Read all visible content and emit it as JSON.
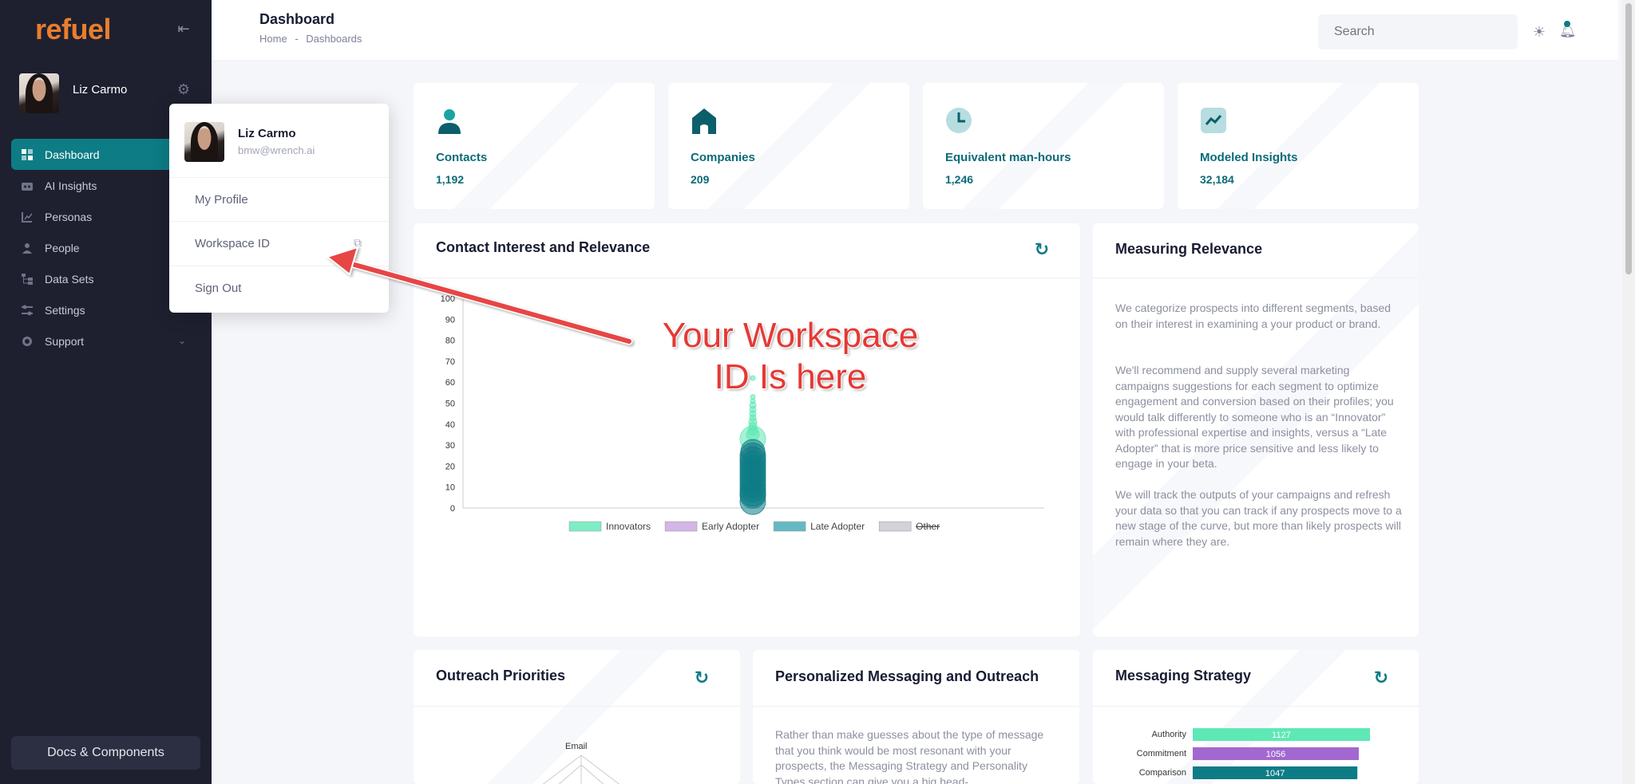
{
  "app": {
    "logo_text": "refuel"
  },
  "sidebar": {
    "user_name": "Liz Carmo",
    "items": [
      {
        "label": "Dashboard",
        "icon": "dashboard-icon",
        "active": true
      },
      {
        "label": "AI Insights",
        "icon": "ai-insights-icon"
      },
      {
        "label": "Personas",
        "icon": "personas-icon"
      },
      {
        "label": "People",
        "icon": "people-icon"
      },
      {
        "label": "Data Sets",
        "icon": "data-sets-icon"
      },
      {
        "label": "Settings",
        "icon": "settings-icon"
      },
      {
        "label": "Support",
        "icon": "support-icon",
        "has_chevron": true
      }
    ],
    "docs_button": "Docs & Components"
  },
  "header": {
    "title": "Dashboard",
    "breadcrumb": [
      "Home",
      "-",
      "Dashboards"
    ],
    "search_placeholder": "Search"
  },
  "stats": [
    {
      "label": "Contacts",
      "value": "1,192",
      "icon": "contact-icon"
    },
    {
      "label": "Companies",
      "value": "209",
      "icon": "building-icon"
    },
    {
      "label": "Equivalent man-hours",
      "value": "1,246",
      "icon": "clock-icon"
    },
    {
      "label": "Modeled Insights",
      "value": "32,184",
      "icon": "trend-icon"
    }
  ],
  "cards": {
    "interest": {
      "title": "Contact Interest and Relevance"
    },
    "measuring": {
      "title": "Measuring Relevance",
      "paragraphs": [
        "We categorize prospects into different segments, based on their interest in examining a your product or brand.",
        "We'll recommend and supply several marketing campaigns suggestions for each segment to optimize engagement and conversion based on their profiles; you would talk differently to someone who is an “Innovator” with professional expertise and insights, versus a “Late Adopter” that is more price sensitive and less likely to engage in your beta.",
        "We will track the outputs of your campaigns and refresh your data so that you can track if any prospects move to a new stage of the curve, but more than likely prospects will remain where they are."
      ]
    },
    "outreach": {
      "title": "Outreach Priorities",
      "radar_label": "Email"
    },
    "personalized": {
      "title": "Personalized Messaging and Outreach",
      "text": "Rather than make guesses about the type of message that you think would be most resonant with your prospects, the Messaging Strategy and Personality Types section can give you a big head-"
    },
    "messaging": {
      "title": "Messaging Strategy"
    }
  },
  "chart_data": [
    {
      "type": "scatter",
      "title": "Contact Interest and Relevance",
      "ylim": [
        0,
        100
      ],
      "yticks": [
        "100",
        "90",
        "80",
        "70",
        "60",
        "50",
        "40",
        "30",
        "20",
        "10",
        "0"
      ],
      "legend": [
        "Innovators",
        "Early Adopter",
        "Late Adopter",
        "Other"
      ],
      "legend_colors": [
        "#5ee8b5",
        "#c8a2e0",
        "#3fa7b3",
        "#c5c8cf"
      ],
      "series": [
        {
          "name": "Innovators",
          "color": "#5ee8b5",
          "y": [
            62,
            53,
            51,
            49,
            47,
            45,
            43,
            41,
            39,
            37,
            35,
            33
          ],
          "r": [
            3,
            3,
            3,
            4,
            4,
            4,
            4,
            5,
            5,
            6,
            8,
            16
          ]
        },
        {
          "name": "Early Adopter",
          "color": "#b58ad8",
          "y": [
            28
          ],
          "r": [
            6
          ]
        },
        {
          "name": "Late Adopter",
          "color": "#0d7c85",
          "y": [
            27,
            25,
            23,
            21,
            19,
            17,
            15,
            13,
            11,
            9,
            7,
            6,
            3
          ],
          "r": [
            15,
            16,
            16,
            16,
            16,
            16,
            16,
            16,
            16,
            16,
            16,
            16,
            16
          ]
        }
      ]
    },
    {
      "type": "bar",
      "title": "Messaging Strategy",
      "categories": [
        "Authority",
        "Commitment",
        "Comparison"
      ],
      "values": [
        1127,
        1056,
        1047
      ],
      "colors": [
        "#5ee8b5",
        "#a268d0",
        "#0d7c85"
      ]
    }
  ],
  "dropdown": {
    "name": "Liz Carmo",
    "email": "bmw@wrench.ai",
    "items": [
      "My Profile",
      "Workspace ID",
      "Sign Out"
    ]
  },
  "annotation": {
    "line1": "Your Workspace",
    "line2": "ID Is here"
  }
}
